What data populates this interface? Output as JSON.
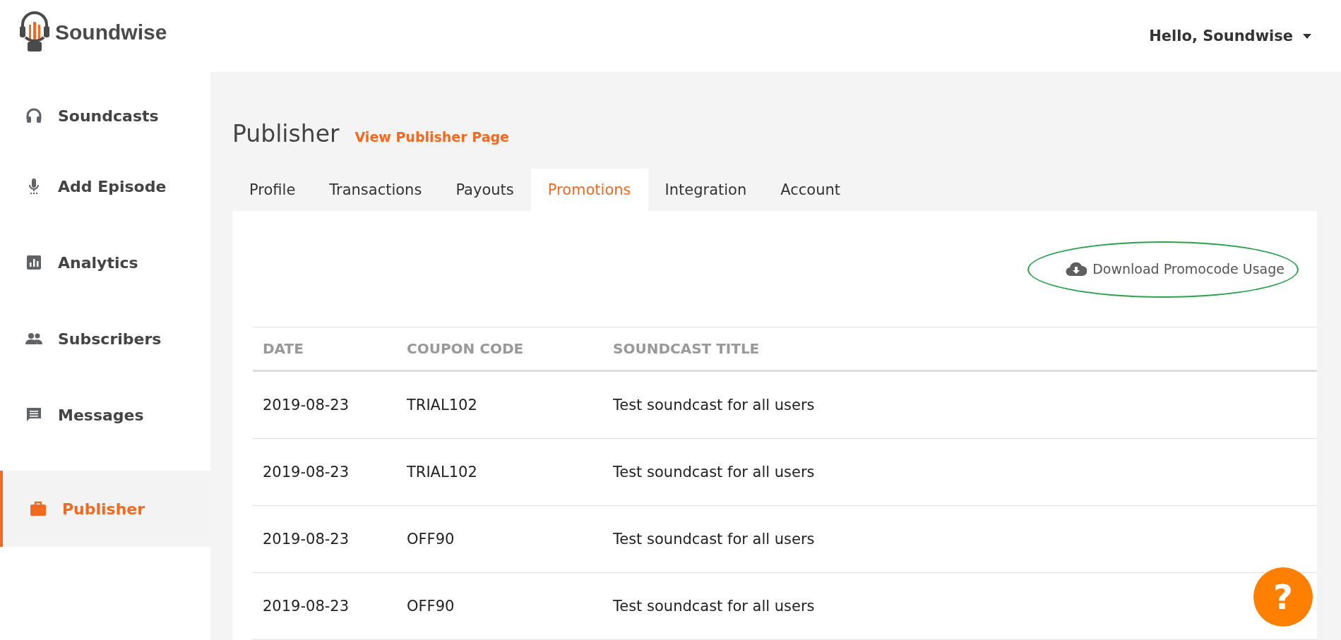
{
  "header": {
    "brand": "Soundwise",
    "user_menu": "Hello, Soundwise"
  },
  "sidebar": {
    "items": [
      {
        "label": "Soundcasts",
        "selected": false
      },
      {
        "label": "Add Episode",
        "selected": false
      },
      {
        "label": "Analytics",
        "selected": false
      },
      {
        "label": "Subscribers",
        "selected": false
      },
      {
        "label": "Messages",
        "selected": false
      },
      {
        "label": "Publisher",
        "selected": true
      }
    ]
  },
  "page": {
    "title": "Publisher",
    "link": "View Publisher Page"
  },
  "tabs": [
    {
      "label": "Profile",
      "selected": false
    },
    {
      "label": "Transactions",
      "selected": false
    },
    {
      "label": "Payouts",
      "selected": false
    },
    {
      "label": "Promotions",
      "selected": true
    },
    {
      "label": "Integration",
      "selected": false
    },
    {
      "label": "Account",
      "selected": false
    }
  ],
  "download": {
    "label": "Download Promocode Usage",
    "highlighted": true
  },
  "table": {
    "columns": [
      "DATE",
      "COUPON CODE",
      "SOUNDCAST TITLE"
    ],
    "rows": [
      [
        "2019-08-23",
        "TRIAL102",
        "Test soundcast for all users"
      ],
      [
        "2019-08-23",
        "TRIAL102",
        "Test soundcast for all users"
      ],
      [
        "2019-08-23",
        "OFF90",
        "Test soundcast for all users"
      ],
      [
        "2019-08-23",
        "OFF90",
        "Test soundcast for all users"
      ]
    ]
  },
  "help_button": "?"
}
